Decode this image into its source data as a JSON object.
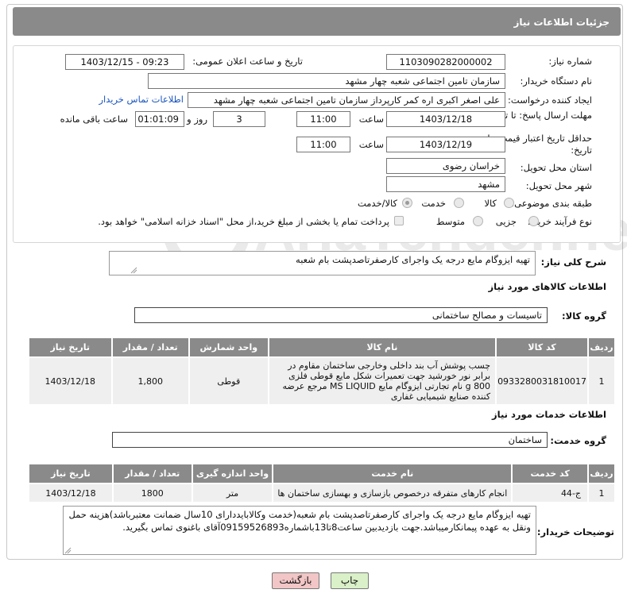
{
  "header": {
    "title": "جزئیات اطلاعات نیاز"
  },
  "form": {
    "need_number_label": "شماره نیاز:",
    "need_number": "1103090282000002",
    "announce_label": "تاریخ و ساعت اعلان عمومی:",
    "announce_value": "1403/12/15 - 09:23",
    "buyer_org_label": "نام دستگاه خریدار:",
    "buyer_org": "سازمان تامین اجتماعی شعبه چهار مشهد",
    "requester_label": "ایجاد کننده درخواست:",
    "requester": "علی اصغر اکبری اره کمر کارپرداز سازمان تامین اجتماعی شعبه چهار مشهد",
    "contact_link": "اطلاعات تماس خریدار",
    "reply_deadline_label": "مهلت ارسال پاسخ: تا تاریخ:",
    "reply_date": "1403/12/18",
    "time_label": "ساعت",
    "reply_time": "11:00",
    "days_value": "3",
    "days_label": "روز و",
    "remaining_time": "01:01:09",
    "remaining_label": "ساعت باقی مانده",
    "price_validity_label": "حداقل تاریخ اعتبار قیمت: تا تاریخ:",
    "price_date": "1403/12/19",
    "price_time": "11:00",
    "province_label": "استان محل تحویل:",
    "province": "خراسان رضوی",
    "city_label": "شهر محل تحویل:",
    "city": "مشهد",
    "category_label": "طبقه بندی موضوعی:",
    "category_options": [
      "کالا",
      "خدمت",
      "کالا/خدمت"
    ],
    "process_label": "نوع فرآیند خرید :",
    "process_options": [
      "جزیی",
      "متوسط"
    ],
    "payment_note": "پرداخت تمام یا بخشی از مبلغ خرید،از محل \"اسناد خزانه اسلامی\" خواهد بود."
  },
  "summary": {
    "label": "شرح کلی نیاز:",
    "value": "تهیه ایزوگام مایع درجه یک واجرای کارصفرتاصدپشت بام شعبه"
  },
  "goods": {
    "section_title": "اطلاعات کالاهای مورد نیاز",
    "group_label": "گروه کالا:",
    "group_value": "تاسیسات و مصالح ساختمانی",
    "columns": [
      "ردیف",
      "کد کالا",
      "نام کالا",
      "واحد شمارش",
      "تعداد / مقدار",
      "تاریخ نیاز"
    ],
    "rows": [
      {
        "row": "1",
        "code": "0933280031810017",
        "name": "چسب پوشش آب بند داخلی وخارجی ساختمان مقاوم در برابر نور خورشید جهت تعمیرات شکل مایع قوطی فلزی 800 g نام تجارتی ایزوگام مایع MS LIQUID مرجع عرضه کننده صنایع شیمیایی غفاری",
        "unit": "قوطی",
        "qty": "1,800",
        "date": "1403/12/18"
      }
    ]
  },
  "services": {
    "section_title": "اطلاعات خدمات مورد نیاز",
    "group_label": "گروه خدمت:",
    "group_value": "ساختمان",
    "columns": [
      "ردیف",
      "کد خدمت",
      "نام خدمت",
      "واحد اندازه گیری",
      "تعداد / مقدار",
      "تاریخ نیاز"
    ],
    "rows": [
      {
        "row": "1",
        "code": "ج-44",
        "name": "انجام کارهای متفرقه درخصوص بازسازی و بهسازی ساختمان ها",
        "unit": "متر",
        "qty": "1800",
        "date": "1403/12/18"
      }
    ]
  },
  "buyer_notes": {
    "label": "توضیحات خریدار:",
    "value": "تهیه ایزوگام مایع درجه یک واجرای کارصفرتاصدپشت بام شعبه(خدمت وکالابایددارای 10سال ضمانت معتبرباشد)هزینه حمل ونقل به عهده پیمانکارمیباشد.جهت بازدیدبین ساعت8تا13باشماره09159526893آقای باغنوی تماس بگیرید."
  },
  "buttons": {
    "print": "چاپ",
    "back": "بازگشت"
  },
  "watermark": {
    "text": "AriaTender.neT"
  },
  "colors": {
    "header_bg": "#8a8a8a",
    "link": "#1a55c0",
    "back_button": "#f2c6c6",
    "print_button": "#d9f0c8"
  }
}
